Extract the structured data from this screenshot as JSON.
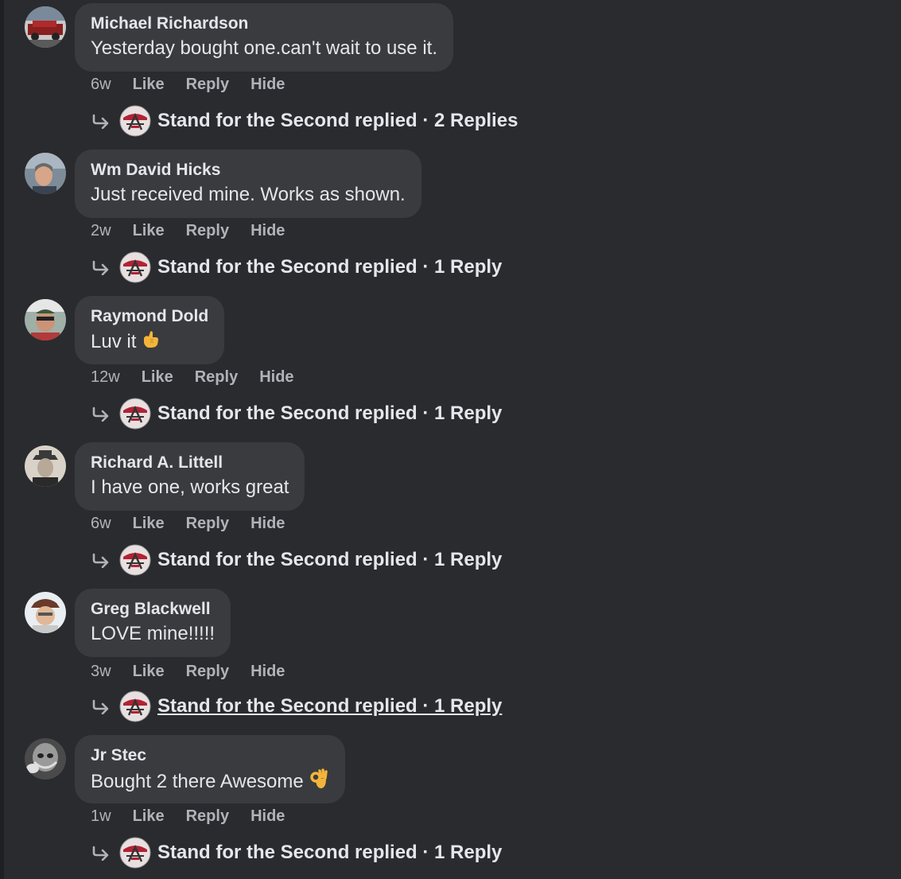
{
  "comments": [
    {
      "author": "Michael Richardson",
      "text": "Yesterday bought one.can't wait to use it.",
      "time": "6w",
      "like": "Like",
      "reply": "Reply",
      "hide": "Hide",
      "reply_line": "Stand for the Second replied · 2 Replies",
      "emoji": ""
    },
    {
      "author": "Wm David Hicks",
      "text": "Just received mine. Works as shown.",
      "time": "2w",
      "like": "Like",
      "reply": "Reply",
      "hide": "Hide",
      "reply_line": "Stand for the Second replied · 1 Reply",
      "emoji": ""
    },
    {
      "author": "Raymond Dold",
      "text": "Luv it",
      "time": "12w",
      "like": "Like",
      "reply": "Reply",
      "hide": "Hide",
      "reply_line": "Stand for the Second replied · 1 Reply",
      "emoji": "call-me-hand-emoji"
    },
    {
      "author": "Richard A. Littell",
      "text": "I have one, works great",
      "time": "6w",
      "like": "Like",
      "reply": "Reply",
      "hide": "Hide",
      "reply_line": "Stand for the Second replied · 1 Reply",
      "emoji": ""
    },
    {
      "author": "Greg Blackwell",
      "text": "LOVE mine!!!!!",
      "time": "3w",
      "like": "Like",
      "reply": "Reply",
      "hide": "Hide",
      "reply_line": "Stand for the Second replied · 1 Reply",
      "emoji": ""
    },
    {
      "author": "Jr Stec",
      "text": "Bought 2 there Awesome",
      "time": "1w",
      "like": "Like",
      "reply": "Reply",
      "hide": "Hide",
      "reply_line": "Stand for the Second replied · 1 Reply",
      "emoji": "ok-hand-emoji"
    }
  ],
  "colors": {
    "background": "#2a2b2e",
    "bubble": "#3a3b3e",
    "primary_text": "#e4e6eb",
    "secondary_text": "#b0b3b8"
  }
}
